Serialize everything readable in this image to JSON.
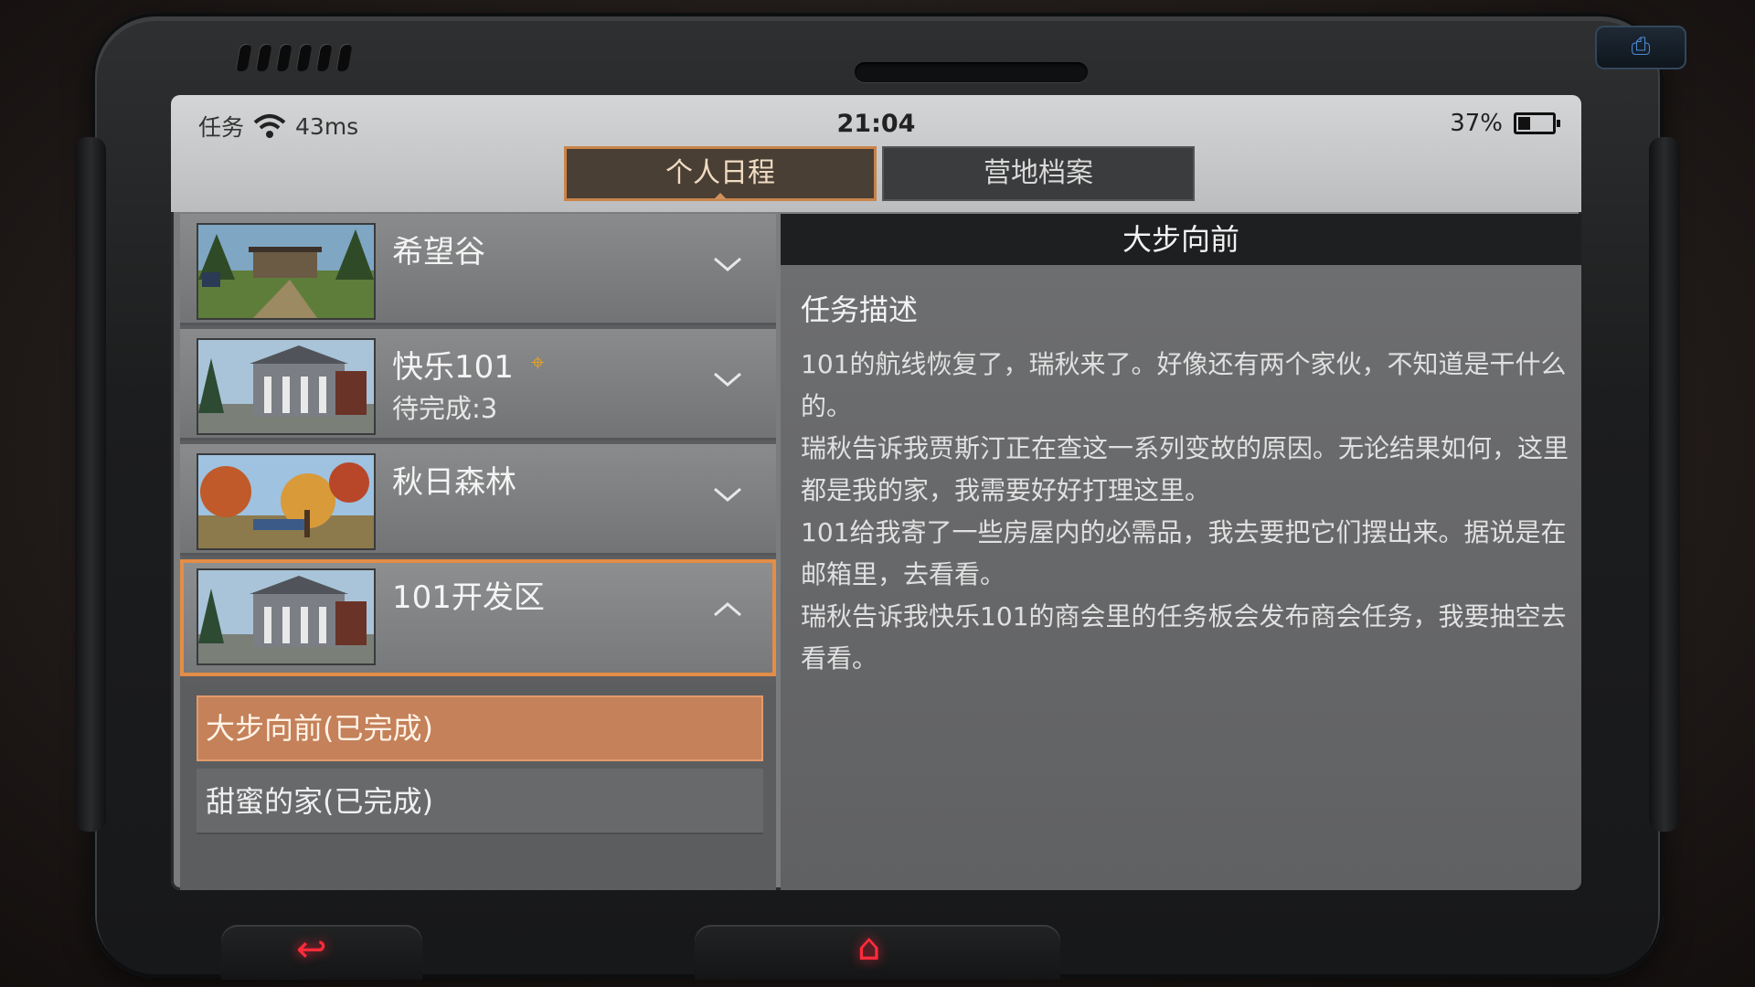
{
  "status": {
    "label": "任务",
    "ping": "43ms",
    "time": "21:04",
    "battery": "37%",
    "battery_level": 0.37
  },
  "tabs": [
    {
      "label": "个人日程",
      "active": true
    },
    {
      "label": "营地档案",
      "active": false
    }
  ],
  "regions": [
    {
      "name": "希望谷",
      "sub": "",
      "expanded": false,
      "selected": false,
      "thumb": "valley-scene"
    },
    {
      "name": "快乐101",
      "sub": "待完成:3",
      "expanded": false,
      "selected": false,
      "thumb": "building-scene",
      "badge_icon": "target-icon"
    },
    {
      "name": "秋日森林",
      "sub": "",
      "expanded": false,
      "selected": false,
      "thumb": "autumn-scene"
    },
    {
      "name": "101开发区",
      "sub": "",
      "expanded": true,
      "selected": true,
      "thumb": "building-scene"
    }
  ],
  "quests": [
    {
      "label": "大步向前(已完成)",
      "active": true
    },
    {
      "label": "甜蜜的家(已完成)",
      "active": false
    }
  ],
  "detail": {
    "title": "大步向前",
    "section": "任务描述",
    "paragraphs": [
      "101的航线恢复了，瑞秋来了。好像还有两个家伙，不知道是干什么的。",
      "瑞秋告诉我贾斯汀正在查这一系列变故的原因。无论结果如何，这里都是我的家，我需要好好打理这里。",
      "101给我寄了一些房屋内的必需品，我去要把它们摆出来。据说是在邮箱里，去看看。",
      "瑞秋告诉我快乐101的商会里的任务板会发布商会任务，我要抽空去看看。"
    ]
  },
  "colors": {
    "accent": "#e48d47",
    "quest_active": "#c4815a",
    "nav_glow": "#ff2b3a"
  }
}
